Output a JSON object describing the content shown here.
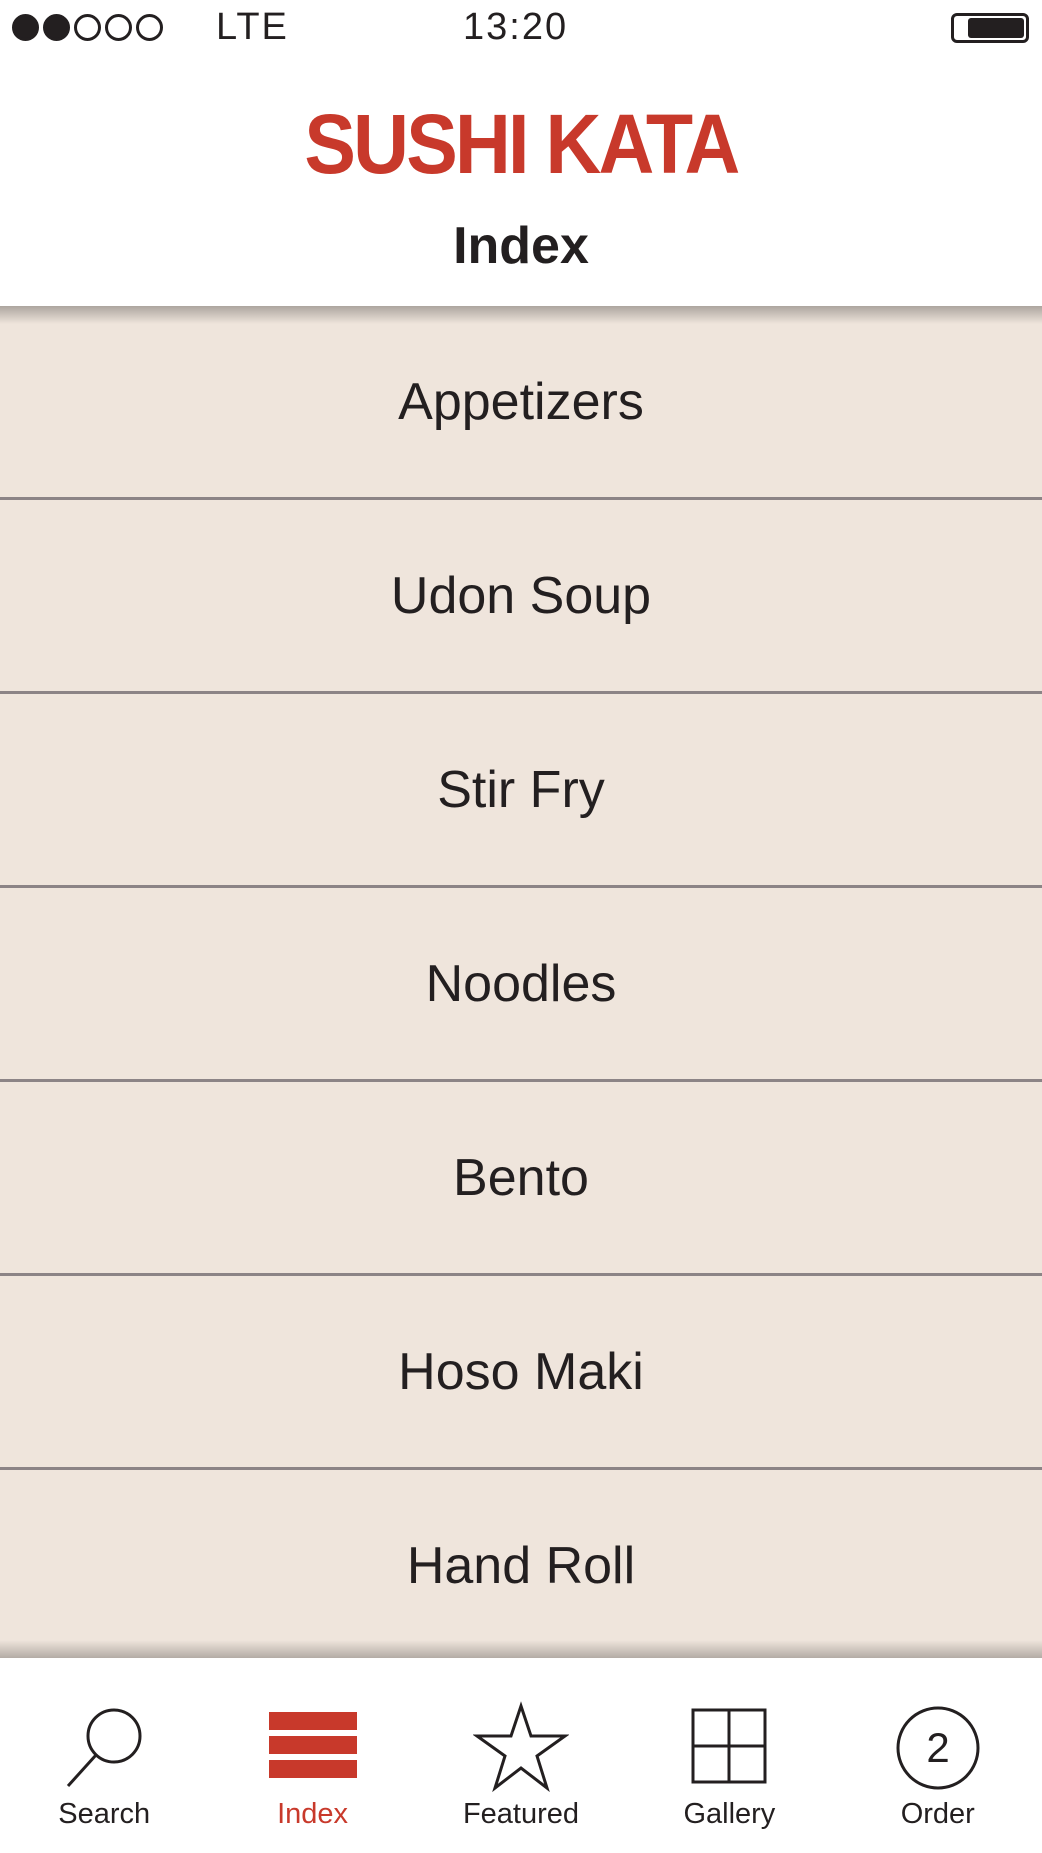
{
  "status_bar": {
    "signal_bars_filled": 2,
    "signal_bars_total": 5,
    "carrier": "LTE",
    "time": "13:20",
    "battery_icon": "battery-icon"
  },
  "header": {
    "brand": "SUSHI KATA",
    "title": "Index"
  },
  "menu": {
    "items": [
      {
        "label": "Appetizers"
      },
      {
        "label": "Udon Soup"
      },
      {
        "label": "Stir Fry"
      },
      {
        "label": "Noodles"
      },
      {
        "label": "Bento"
      },
      {
        "label": "Hoso Maki"
      },
      {
        "label": "Hand Roll"
      }
    ]
  },
  "tab_bar": {
    "tabs": [
      {
        "label": "Search",
        "icon": "search-icon",
        "active": false
      },
      {
        "label": "Index",
        "icon": "list-icon",
        "active": true
      },
      {
        "label": "Featured",
        "icon": "star-icon",
        "active": false
      },
      {
        "label": "Gallery",
        "icon": "grid-icon",
        "active": false
      },
      {
        "label": "Order",
        "icon": "order-count-icon",
        "badge": "2",
        "active": false
      }
    ]
  },
  "colors": {
    "brand": "#c8392b",
    "list_background": "#efe5dc",
    "divider": "#8c8486",
    "text": "#231f20"
  }
}
